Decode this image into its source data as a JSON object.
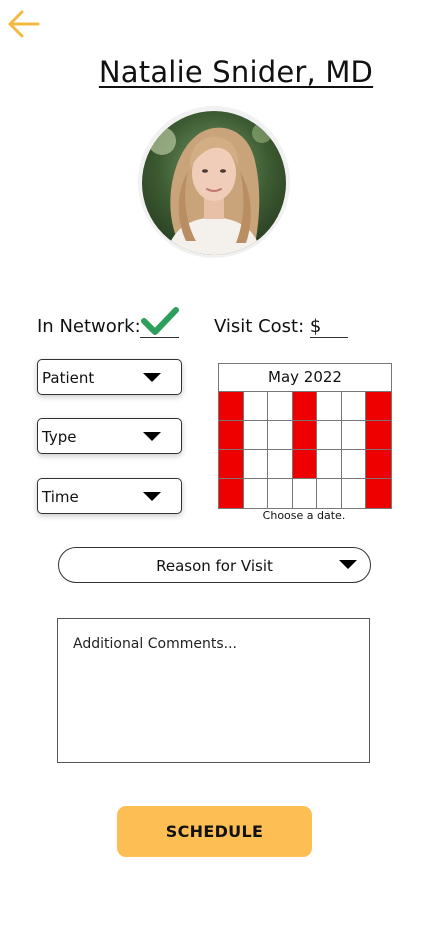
{
  "header": {
    "doctor_name": "Natalie Snider, MD"
  },
  "network": {
    "label": "In Network:",
    "checked": true
  },
  "cost": {
    "label": "Visit Cost: $",
    "value": ""
  },
  "dropdowns": {
    "patient": "Patient",
    "type": "Type",
    "time": "Time"
  },
  "calendar": {
    "month": "May 2022",
    "caption": "Choose a date.",
    "busy_cells": [
      0,
      3,
      6,
      7,
      10,
      13,
      14,
      17,
      20,
      21,
      27
    ]
  },
  "reason": {
    "label": "Reason for Visit"
  },
  "comments": {
    "placeholder": "Additional Comments..."
  },
  "actions": {
    "schedule": "SCHEDULE"
  },
  "colors": {
    "accent": "#fdbf53",
    "back_arrow": "#f4b940",
    "check": "#2e9e5b",
    "busy": "#ee0000"
  },
  "icons": {
    "back": "arrow-left-icon",
    "check": "checkmark-icon",
    "caret": "caret-down-icon"
  }
}
